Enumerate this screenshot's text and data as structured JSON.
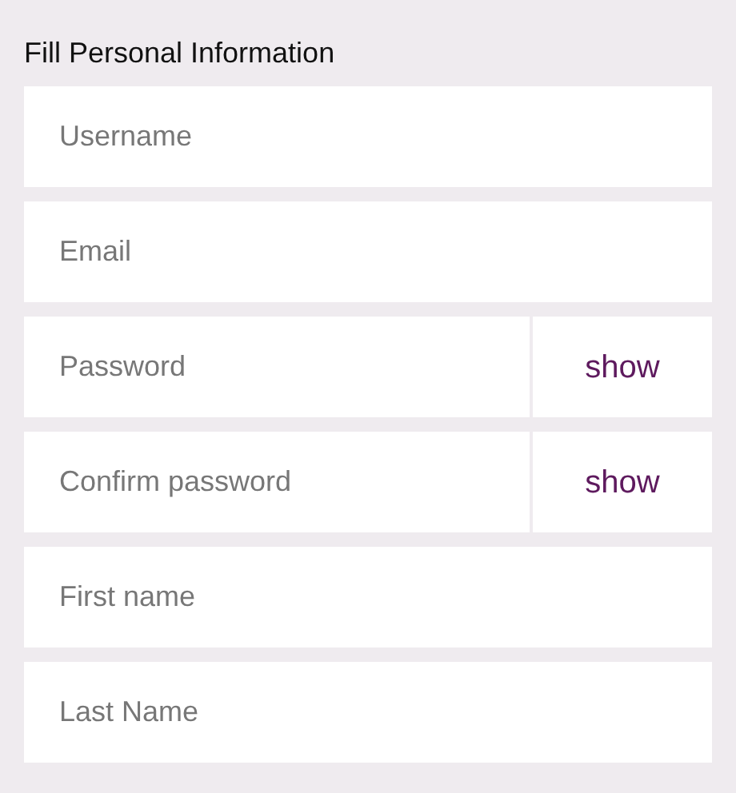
{
  "title": "Fill Personal Information",
  "fields": [
    {
      "kind": "text",
      "placeholder": "Username"
    },
    {
      "kind": "text",
      "placeholder": "Email"
    },
    {
      "kind": "secret",
      "placeholder": "Password",
      "toggle": "show"
    },
    {
      "kind": "secret",
      "placeholder": "Confirm password",
      "toggle": "show"
    },
    {
      "kind": "text",
      "placeholder": "First name"
    },
    {
      "kind": "text",
      "placeholder": "Last Name"
    }
  ]
}
